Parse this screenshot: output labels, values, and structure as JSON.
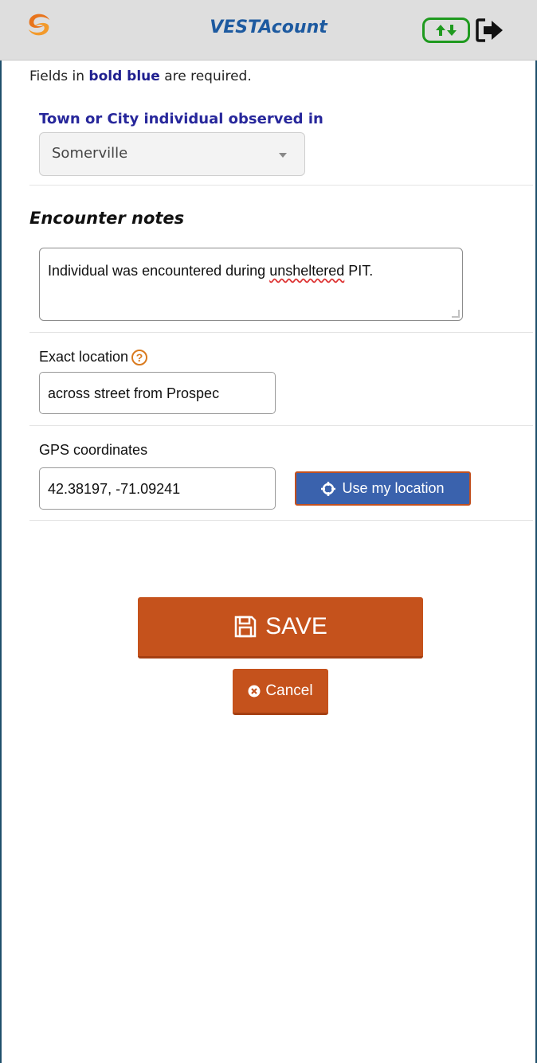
{
  "header": {
    "app_title": "VESTAcount",
    "logo_icon": "vesta-swirl-logo",
    "sync_icon": "sync-up-down-icon",
    "logout_icon": "logout-arrow-icon"
  },
  "form": {
    "required_note": {
      "prefix": "Fields in ",
      "bold": "bold blue",
      "suffix": " are required."
    },
    "town": {
      "label": "Town or City individual observed in",
      "value": "Somerville"
    },
    "encounter": {
      "heading": "Encounter notes",
      "text_before": "Individual was encountered during ",
      "text_misspelled": "unsheltered",
      "text_after": " PIT."
    },
    "location": {
      "label": "Exact location",
      "help_icon": "?",
      "value": "across street from Prospec"
    },
    "gps": {
      "label": "GPS coordinates",
      "value": "42.38197, -71.09241",
      "use_location_label": "Use my location"
    }
  },
  "actions": {
    "save_label": "SAVE",
    "cancel_label": "Cancel"
  },
  "colors": {
    "accent": "#c5521c",
    "title_blue": "#1d5aa0",
    "required_blue": "#27279b",
    "location_button": "#3a62ad",
    "sync_green": "#1f9a1f"
  }
}
